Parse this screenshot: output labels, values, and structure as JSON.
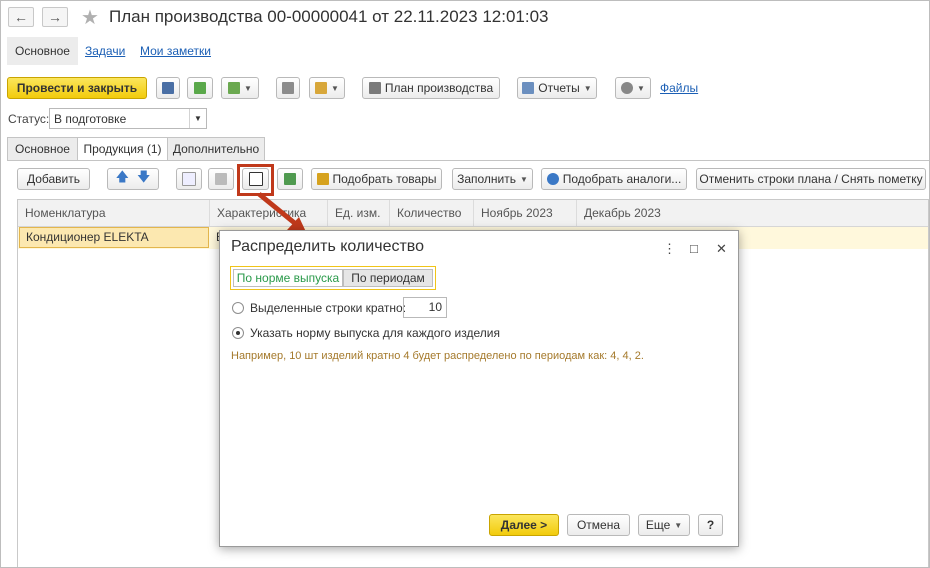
{
  "window": {
    "title": "План производства 00-00000041 от 22.11.2023 12:01:03",
    "back_glyph": "←",
    "forward_glyph": "→",
    "favorite_glyph": "★"
  },
  "top_nav": {
    "main": "Основное",
    "tasks": "Задачи",
    "notes": "Мои заметки"
  },
  "toolbar": {
    "post_close": "Провести и закрыть",
    "plan_print": "План производства",
    "reports": "Отчеты",
    "files": "Файлы"
  },
  "status": {
    "label": "Статус:",
    "value": "В подготовке"
  },
  "tabs": [
    "Основное",
    "Продукция (1)",
    "Дополнительно"
  ],
  "table_toolbar": {
    "add": "Добавить",
    "pick_goods": "Подобрать товары",
    "fill": "Заполнить",
    "pick_analogs": "Подобрать аналоги...",
    "cancel_rows": "Отменить строки плана / Снять пометку"
  },
  "table": {
    "columns": [
      "Номенклатура",
      "Характеристика",
      "Ед. изм.",
      "Количество",
      "Ноябрь 2023",
      "Декабрь 2023"
    ],
    "rows": [
      {
        "nomenclature": "Кондиционер ELEKTA",
        "char_partial": "E"
      }
    ]
  },
  "dialog": {
    "title": "Распределить количество",
    "segment_by_norm": "По норме выпуска",
    "segment_by_periods": "По периодам",
    "option_multiple": "Выделенные строки кратно:",
    "multiple_value": "10",
    "option_norm": "Указать норму выпуска для каждого изделия",
    "hint": "Например, 10 шт изделий кратно 4 будет распределено по периодам как: 4, 4, 2.",
    "next": "Далее >",
    "cancel": "Отмена",
    "more": "Еще",
    "help": "?",
    "menu_glyph": "⋮",
    "maximize_glyph": "□",
    "close_glyph": "✕"
  },
  "colors": {
    "accent_yellow": "#f2cb0c",
    "callout_red": "#c0391b",
    "hint_text": "#a57a2c",
    "link_blue": "#1b5fb5"
  }
}
